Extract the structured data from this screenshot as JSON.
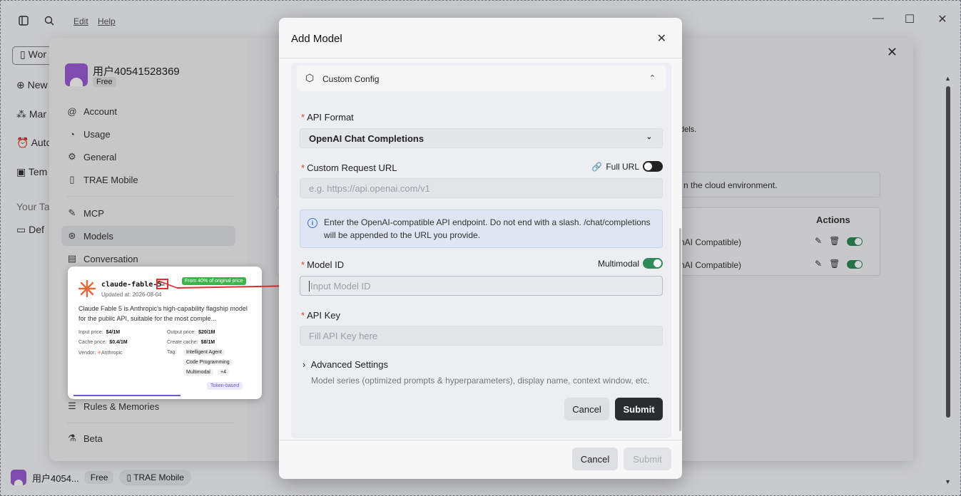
{
  "menu": {
    "edit": "Edit",
    "help": "Help"
  },
  "leftnav": {
    "items": [
      {
        "label": "Wor",
        "icon": "book-icon"
      },
      {
        "label": "New",
        "icon": "plus-circle-icon"
      },
      {
        "label": "Mar",
        "icon": "grid-icon"
      },
      {
        "label": "Auto",
        "icon": "alarm-icon"
      },
      {
        "label": "Tem",
        "icon": "template-icon"
      },
      {
        "label": "Your Ta",
        "icon": ""
      },
      {
        "label": "Def",
        "icon": "folder-icon"
      }
    ]
  },
  "bottombar": {
    "user": "用户4054...",
    "plan": "Free",
    "mobile": "TRAE Mobile"
  },
  "profile": {
    "name": "用户40541528369",
    "plan": "Free"
  },
  "settings_nav": [
    {
      "label": "Account",
      "icon": "at-icon"
    },
    {
      "label": "Usage",
      "icon": "gauge-icon"
    },
    {
      "label": "General",
      "icon": "gear-icon"
    },
    {
      "label": "TRAE Mobile",
      "icon": "phone-icon"
    },
    {
      "label": "MCP",
      "icon": "wrench-icon"
    },
    {
      "label": "Models",
      "icon": "cube-icon"
    },
    {
      "label": "Conversation",
      "icon": "chat-icon"
    },
    {
      "label": "Rules & Memories",
      "icon": "doc-icon"
    },
    {
      "label": "Beta",
      "icon": "flask-icon"
    }
  ],
  "behind": {
    "models_suffix": "dels.",
    "cloud_notice": "n the cloud environment.",
    "actions_header": "Actions",
    "row1": "nAI Compatible)",
    "row2": "nAI Compatible)"
  },
  "card": {
    "name": "claude-fable-5",
    "updated": "Updated at:  2026-08-04",
    "badge": "From 40% of original price",
    "desc": "Claude Fable 5 is Anthropic's high-capability flagship model for the public API, suitable for the most comple...",
    "input_label": "Input price:",
    "input_value": "$4/1M",
    "output_label": "Output price:",
    "output_value": "$20/1M",
    "cache_label": "Cache price:",
    "cache_value": "$0.4/1M",
    "create_label": "Create cache:",
    "create_value": "$8/1M",
    "vendor_label": "Vendor:",
    "vendor_value": "Anthropic",
    "tag_label": "Tag:",
    "tags": [
      "Intelligent Agent",
      "Code Programming",
      "Multimodal",
      "+4"
    ],
    "billing": "Token-based"
  },
  "modal": {
    "title": "Add Model",
    "section": "Custom Config",
    "api_format_label": "API Format",
    "api_format_value": "OpenAI Chat Completions",
    "url_label": "Custom Request URL",
    "full_url": "Full URL",
    "url_placeholder": "e.g. https://api.openai.com/v1",
    "info": "Enter the OpenAI-compatible API endpoint. Do not end with a slash. /chat/completions will be appended to the URL you provide.",
    "model_id_label": "Model ID",
    "multimodal": "Multimodal",
    "model_id_placeholder": "Input Model ID",
    "api_key_label": "API Key",
    "api_key_placeholder": "Fill API Key here",
    "advanced": "Advanced Settings",
    "advanced_desc": "Model series (optimized prompts & hyperparameters), display name, context window, etc.",
    "cancel": "Cancel",
    "submit": "Submit",
    "footer_cancel": "Cancel",
    "footer_submit": "Submit"
  },
  "colors": {
    "accent_green": "#2e8b57",
    "required": "#d9453b",
    "primary_button": "#2a2c30"
  }
}
